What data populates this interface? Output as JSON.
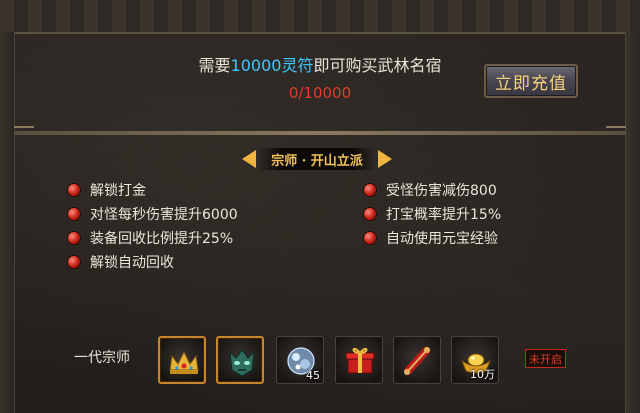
{
  "header": {
    "need_prefix": "需要",
    "need_amount": "10000灵符",
    "need_suffix": "即可购买武林名宿",
    "progress": "0/10000",
    "recharge_button": "立即充值"
  },
  "section": {
    "title": "宗师 · 开山立派"
  },
  "perks_left": [
    "解锁打金",
    "对怪每秒伤害提升6000",
    "装备回收比例提升25%",
    "解锁自动回收"
  ],
  "perks_right": [
    "受怪伤害减伤800",
    "打宝概率提升15%",
    "自动使用元宝经验"
  ],
  "rewards": {
    "row_label": "一代宗师",
    "items": [
      {
        "icon": "golden-crown-icon",
        "count": ""
      },
      {
        "icon": "jade-mask-icon",
        "count": ""
      },
      {
        "icon": "crystal-ore-icon",
        "count": "45"
      },
      {
        "icon": "red-gift-box-icon",
        "count": ""
      },
      {
        "icon": "red-scroll-icon",
        "count": ""
      },
      {
        "icon": "gold-ingot-icon",
        "count": "10万"
      }
    ],
    "locked_label": "未开启"
  },
  "colors": {
    "accent_blue": "#3ec8ff",
    "progress_red": "#e23a2c",
    "title_gold": "#f3c25a",
    "button_text": "#f4d27a"
  }
}
